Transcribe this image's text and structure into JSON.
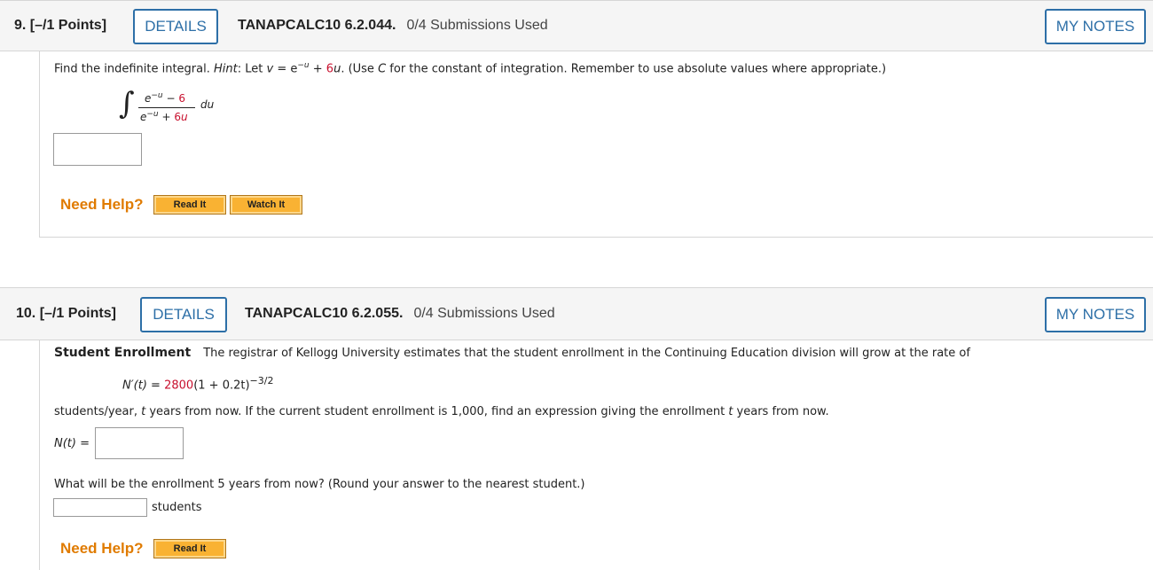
{
  "q9": {
    "number": "9.  [–/1 Points]",
    "details": "DETAILS",
    "code": "TANAPCALC10 6.2.044.",
    "submissions": "0/4 Submissions Used",
    "notes": "MY NOTES",
    "prompt_a": "Find the indefinite integral. ",
    "prompt_hint": "Hint",
    "prompt_b": ": Let ",
    "prompt_v": "v",
    "prompt_c": " = e",
    "prompt_exp": "−u",
    "prompt_d": " + ",
    "prompt_red": "6",
    "prompt_u": "u",
    "prompt_e": ". (Use ",
    "prompt_C": "C",
    "prompt_f": " for the constant of integration. Remember to use absolute values where appropriate.)",
    "numerator_base": "e",
    "numerator_exp": "−u",
    "numerator_rest": " − ",
    "numerator_red": "6",
    "denominator_base": "e",
    "denominator_exp": "−u",
    "denominator_rest": " + ",
    "denominator_red": "6",
    "denominator_u": "u",
    "du": "du",
    "answer_value": "",
    "help_label": "Need Help?",
    "read_it": "Read It",
    "watch_it": "Watch It"
  },
  "q10": {
    "number": "10.  [–/1 Points]",
    "details": "DETAILS",
    "code": "TANAPCALC10 6.2.055.",
    "submissions": "0/4 Submissions Used",
    "notes": "MY NOTES",
    "title": "Student Enrollment",
    "intro": "The registrar of Kellogg University estimates that the student enrollment in the Continuing Education division will grow at the rate of",
    "rate_lhs": "N′(t)",
    "rate_eq": " = ",
    "rate_red": "2800",
    "rate_rest": "(1 + 0.2t)",
    "rate_exp": "−3/2",
    "line2_a": "students/year, ",
    "line2_t": "t",
    "line2_b": " years from now. If the current student enrollment is 1,000, find an expression giving the enrollment ",
    "line2_t2": "t",
    "line2_c": " years from now.",
    "nt_label": "N(t) =",
    "nt_value": "",
    "q2": "What will be the enrollment 5 years from now? (Round your answer to the nearest student.)",
    "students_value": "",
    "students_unit": "students",
    "help_label": "Need Help?",
    "read_it": "Read It"
  }
}
